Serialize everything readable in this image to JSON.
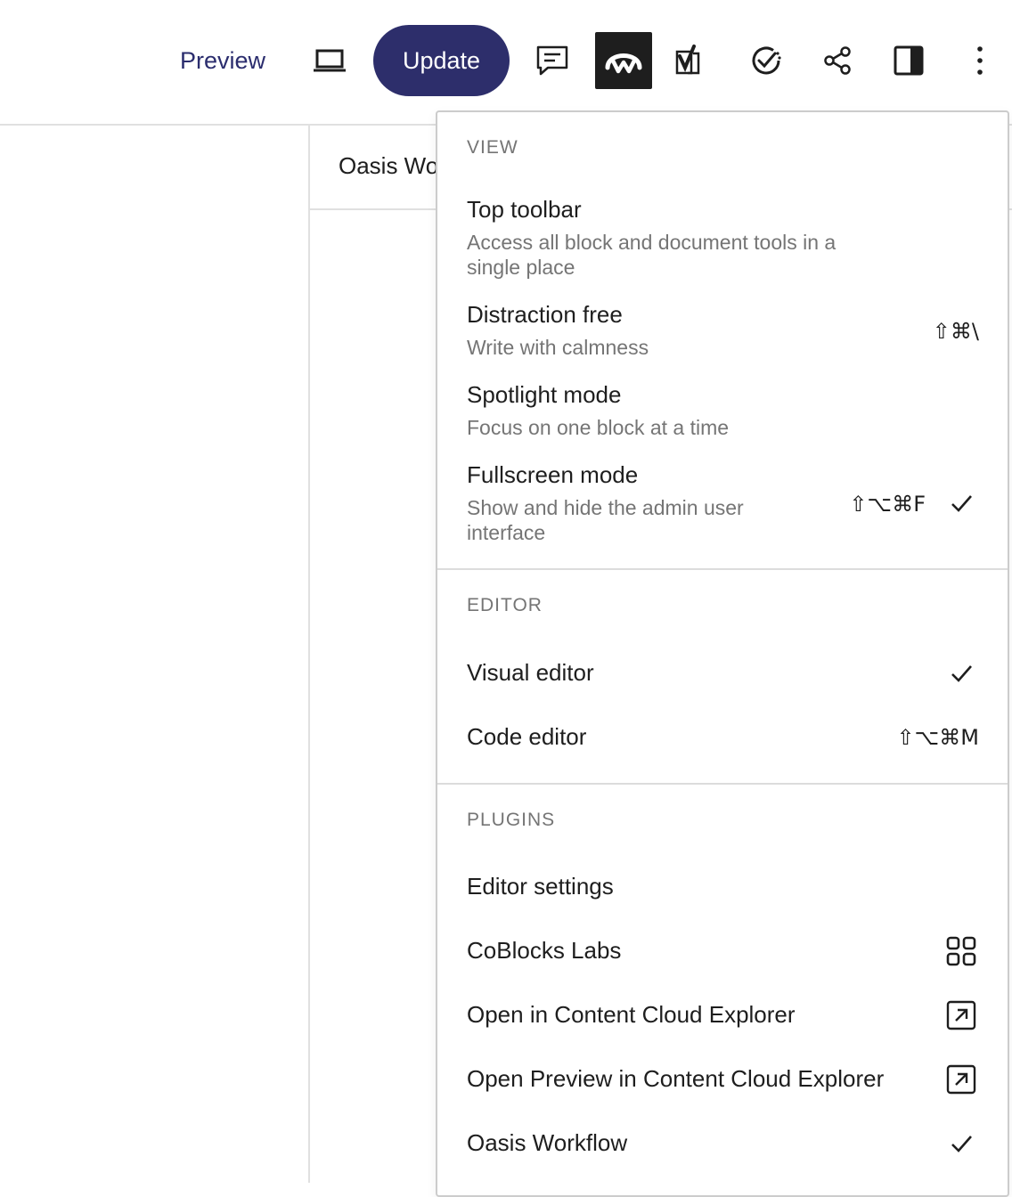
{
  "toolbar": {
    "preview_label": "Preview",
    "update_label": "Update",
    "icons": [
      "device-preview-icon",
      "comments-icon",
      "wordlift-icon",
      "yoast-icon",
      "checklist-icon",
      "share-icon",
      "settings-sidebar-icon",
      "more-options-icon"
    ]
  },
  "panel": {
    "title": "Oasis Wo"
  },
  "menu": {
    "view": {
      "label": "VIEW",
      "items": [
        {
          "label": "Top toolbar",
          "desc": "Access all block and document tools in a single place"
        },
        {
          "label": "Distraction free",
          "desc": "Write with calmness",
          "shortcut": "⇧⌘\\"
        },
        {
          "label": "Spotlight mode",
          "desc": "Focus on one block at a time"
        },
        {
          "label": "Fullscreen mode",
          "desc": "Show and hide the admin user interface",
          "shortcut": "⇧⌥⌘F",
          "checked": true
        }
      ]
    },
    "editor": {
      "label": "EDITOR",
      "items": [
        {
          "label": "Visual editor",
          "checked": true
        },
        {
          "label": "Code editor",
          "shortcut": "⇧⌥⌘M"
        }
      ]
    },
    "plugins": {
      "label": "PLUGINS",
      "items": [
        {
          "label": "Editor settings"
        },
        {
          "label": "CoBlocks Labs",
          "icon": "grid-icon"
        },
        {
          "label": "Open in Content Cloud Explorer",
          "icon": "external-link-icon"
        },
        {
          "label": "Open Preview in Content Cloud Explorer",
          "icon": "external-link-icon"
        },
        {
          "label": "Oasis Workflow",
          "checked": true
        }
      ]
    }
  }
}
